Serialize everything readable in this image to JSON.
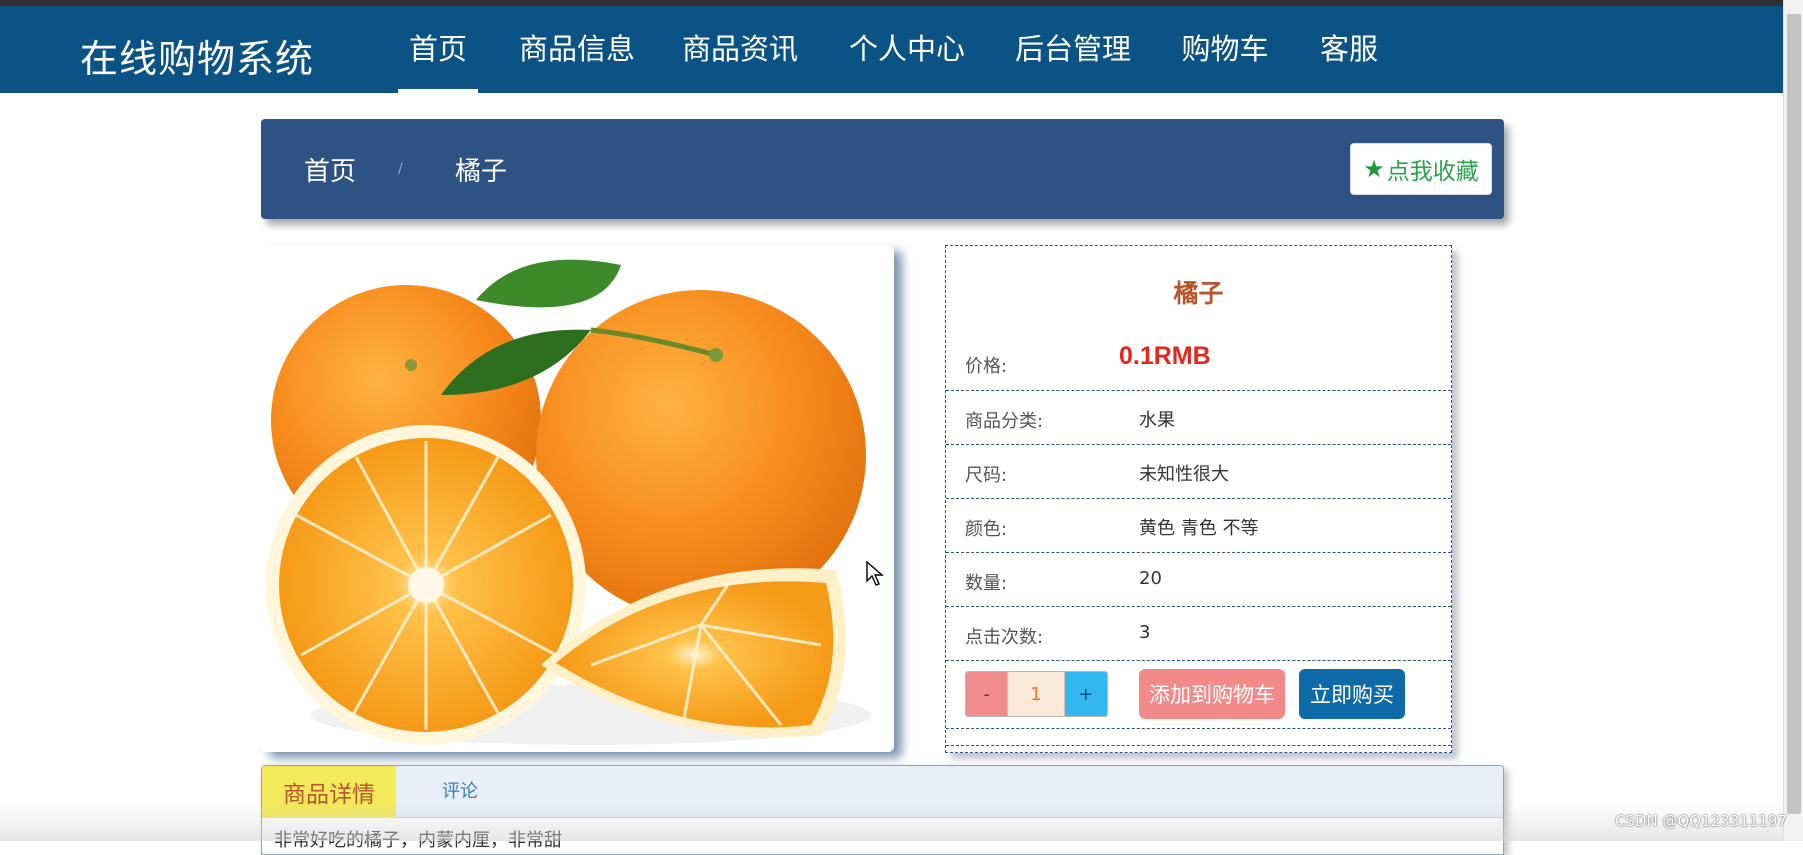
{
  "navbar": {
    "brand": "在线购物系统",
    "items": [
      {
        "label": "首页",
        "active": true
      },
      {
        "label": "商品信息",
        "active": false
      },
      {
        "label": "商品资讯",
        "active": false
      },
      {
        "label": "个人中心",
        "active": false
      },
      {
        "label": "后台管理",
        "active": false
      },
      {
        "label": "购物车",
        "active": false
      },
      {
        "label": "客服",
        "active": false
      }
    ]
  },
  "breadcrumb": {
    "home": "首页",
    "separator": "/",
    "current": "橘子",
    "favorite_label": "点我收藏"
  },
  "product": {
    "image_icon": "orange-fruit-photo",
    "title": "橘子",
    "price_label": "价格:",
    "price": "0.1RMB",
    "rows": [
      {
        "label": "商品分类:",
        "value": "水果"
      },
      {
        "label": "尺码:",
        "value": "未知性很大"
      },
      {
        "label": "颜色:",
        "value": "黄色 青色 不等"
      },
      {
        "label": "数量:",
        "value": "20"
      },
      {
        "label": "点击次数:",
        "value": "3"
      }
    ],
    "stepper": {
      "minus": "-",
      "quantity": "1",
      "plus": "+"
    },
    "add_to_cart": "添加到购物车",
    "buy_now": "立即购买"
  },
  "tabs": {
    "details": "商品详情",
    "comments": "评论",
    "description": "非常好吃的橘子，内蒙内厘，非常甜"
  },
  "watermark": "CSDN @QQ123311197",
  "colors": {
    "navbar_bg": "#0b5384",
    "breadcrumb_bg": "#2d5283",
    "price": "#e8241b",
    "title": "#b5562f",
    "favorite_text": "#2aa34a"
  }
}
